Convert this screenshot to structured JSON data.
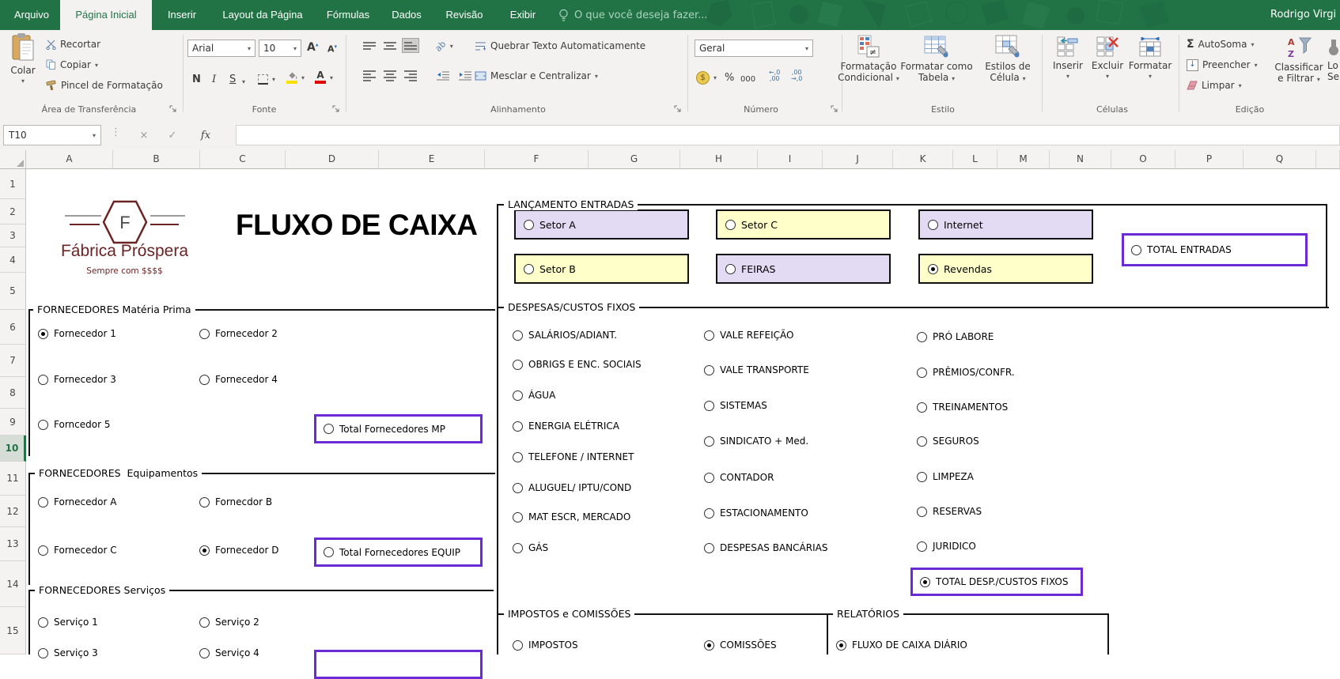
{
  "app": {
    "user": "Rodrigo Virgi"
  },
  "tabs": {
    "file": "Arquivo",
    "items": [
      "Página Inicial",
      "Inserir",
      "Layout da Página",
      "Fórmulas",
      "Dados",
      "Revisão",
      "Exibir"
    ],
    "selected": "Página Inicial",
    "search": "O que você deseja fazer..."
  },
  "ribbon": {
    "clipboard": {
      "label": "Área de Transferência",
      "paste": "Colar",
      "cut": "Recortar",
      "copy": "Copiar",
      "painter": "Pincel de Formatação"
    },
    "font": {
      "label": "Fonte",
      "family": "Arial",
      "size": "10",
      "bold": "N",
      "italic": "I",
      "underline": "S"
    },
    "alignment": {
      "label": "Alinhamento",
      "wrap": "Quebrar Texto Automaticamente",
      "merge": "Mesclar e Centralizar"
    },
    "number": {
      "label": "Número",
      "format": "Geral",
      "currency": "$",
      "percent": "%",
      "thousands": "000",
      "dec_inc_top": "←,0",
      "dec_inc_bot": ",00",
      "dec_dec_top": ",00",
      "dec_dec_bot": "→,0"
    },
    "style": {
      "label": "Estilo",
      "conditional_1": "Formatação",
      "conditional_2": "Condicional",
      "table_1": "Formatar como",
      "table_2": "Tabela",
      "cellstyles_1": "Estilos de",
      "cellstyles_2": "Célula"
    },
    "cells": {
      "label": "Células",
      "insert": "Inserir",
      "delete": "Excluir",
      "format": "Formatar"
    },
    "editing": {
      "label": "Edição",
      "autosum": "AutoSoma",
      "fill": "Preencher",
      "clear": "Limpar",
      "sort_1": "Classificar",
      "sort_2": "e Filtrar",
      "find_1": "Lo",
      "find_2": "Se"
    }
  },
  "formula_bar": {
    "name_box": "T10",
    "fx": "fx",
    "value": ""
  },
  "grid": {
    "columns": [
      "A",
      "B",
      "C",
      "D",
      "E",
      "F",
      "G",
      "H",
      "I",
      "J",
      "K",
      "L",
      "M",
      "N",
      "O",
      "P",
      "Q"
    ],
    "rows": [
      "1",
      "2",
      "3",
      "4",
      "5",
      "6",
      "7",
      "8",
      "9",
      "10",
      "11",
      "12",
      "13",
      "14",
      "15"
    ],
    "active_cell": "T10",
    "active_row": "10"
  },
  "sheet": {
    "logo": {
      "initial": "F",
      "company": "Fábrica Próspera",
      "tagline": "Sempre com $$$$"
    },
    "title": "FLUXO DE CAIXA",
    "lancamento": {
      "label": "LANÇAMENTO ENTRADAS",
      "boxes": [
        {
          "label": "Setor A",
          "color": "lavender",
          "selected": false
        },
        {
          "label": "Setor C",
          "color": "yellow",
          "selected": false
        },
        {
          "label": "Internet",
          "color": "lavender",
          "selected": false
        },
        {
          "label": "Setor B",
          "color": "yellow",
          "selected": false
        },
        {
          "label": "FEIRAS",
          "color": "lavender",
          "selected": false
        },
        {
          "label": "Revendas",
          "color": "yellow",
          "selected": true
        }
      ],
      "total": "TOTAL ENTRADAS",
      "total_selected": false
    },
    "fornecedores_mp": {
      "label": "FORNECEDORES Matéria Prima",
      "items": [
        "Fornecedor 1",
        "Fornecedor 2",
        "Fornecedor 3",
        "Fornecedor 4",
        "Forncedor 5"
      ],
      "selected": "Fornecedor 1",
      "total": "Total Fornecedores MP",
      "total_selected": false
    },
    "fornecedores_equip": {
      "label": "FORNECEDORES  Equipamentos",
      "items": [
        "Fornecedor A",
        "Fornecdor B",
        "Fornecedor C",
        "Fornecedor D"
      ],
      "selected": "Fornecedor D",
      "total": "Total Fornecedores EQUIP",
      "total_selected": false
    },
    "fornecedores_serv": {
      "label": "FORNECEDORES Serviços",
      "items": [
        "Serviço 1",
        "Serviço 2",
        "Serviço 3",
        "Serviço 4"
      ]
    },
    "despesas": {
      "label": "DESPESAS/CUSTOS FIXOS",
      "col1": [
        "SALÁRIOS/ADIANT.",
        "OBRIGS E ENC. SOCIAIS",
        "ÁGUA",
        "ENERGIA ELÉTRICA",
        "TELEFONE / INTERNET",
        "ALUGUEL/ IPTU/COND",
        "MAT ESCR, MERCADO",
        "GÁS"
      ],
      "col2": [
        "VALE REFEIÇÃO",
        "VALE TRANSPORTE",
        "SISTEMAS",
        "SINDICATO + Med.",
        "CONTADOR",
        "ESTACIONAMENTO",
        "DESPESAS BANCÁRIAS"
      ],
      "col3": [
        "PRÓ LABORE",
        "PRÊMIOS/CONFR.",
        "TREINAMENTOS",
        "SEGUROS",
        "LIMPEZA",
        "RESERVAS",
        "JURIDICO"
      ],
      "total": "TOTAL DESP./CUSTOS FIXOS",
      "total_selected": true
    },
    "impostos": {
      "label": "IMPOSTOS e COMISSÕES",
      "items": [
        "IMPOSTOS",
        "COMISSÕES"
      ],
      "selected": "COMISSÕES"
    },
    "relatorios": {
      "label": "RELATÓRIOS",
      "items": [
        "FLUXO DE CAIXA DIÁRIO"
      ],
      "selected": "FLUXO DE CAIXA DIÁRIO"
    }
  },
  "colors": {
    "excel_green": "#217346",
    "purple": "#6A2BD7",
    "lavender": "#E3DAF4",
    "yellow": "#FFFFC9",
    "maroon": "#6B2323"
  },
  "icons": {
    "dropdown": "▾",
    "dots": "⋮",
    "cancel": "×",
    "confirm": "✓",
    "sigma": "Σ",
    "orientation": "ab",
    "sort_a": "A",
    "sort_z": "Z",
    "neq": "≠",
    "arrow_down": "↓"
  }
}
